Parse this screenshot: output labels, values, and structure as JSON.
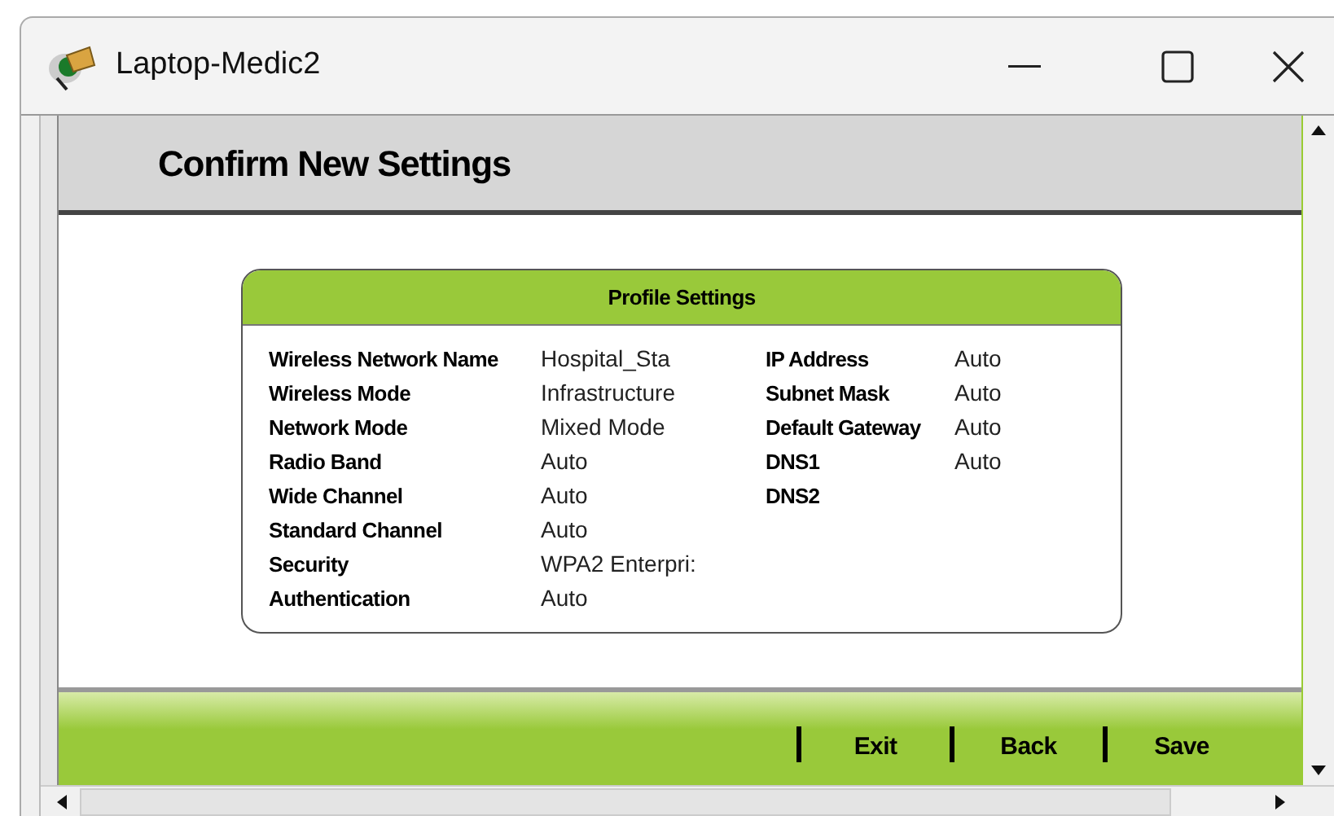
{
  "window": {
    "title": "Laptop-Medic2"
  },
  "page": {
    "title": "Confirm New Settings"
  },
  "profile": {
    "title": "Profile Settings",
    "left": [
      {
        "label": "Wireless Network Name",
        "value": "Hospital_Sta"
      },
      {
        "label": "Wireless Mode",
        "value": "Infrastructure"
      },
      {
        "label": "Network Mode",
        "value": "Mixed Mode"
      },
      {
        "label": "Radio Band",
        "value": "Auto"
      },
      {
        "label": "Wide Channel",
        "value": "Auto"
      },
      {
        "label": "Standard Channel",
        "value": "Auto"
      },
      {
        "label": "Security",
        "value": "WPA2 Enterpri:"
      },
      {
        "label": "Authentication",
        "value": "Auto"
      }
    ],
    "right": [
      {
        "label": "IP Address",
        "value": "Auto"
      },
      {
        "label": "Subnet Mask",
        "value": "Auto"
      },
      {
        "label": "Default Gateway",
        "value": "Auto"
      },
      {
        "label": "DNS1",
        "value": "Auto"
      },
      {
        "label": "DNS2"
      }
    ]
  },
  "footer": {
    "buttons": [
      "Exit",
      "Back",
      "Save"
    ]
  }
}
